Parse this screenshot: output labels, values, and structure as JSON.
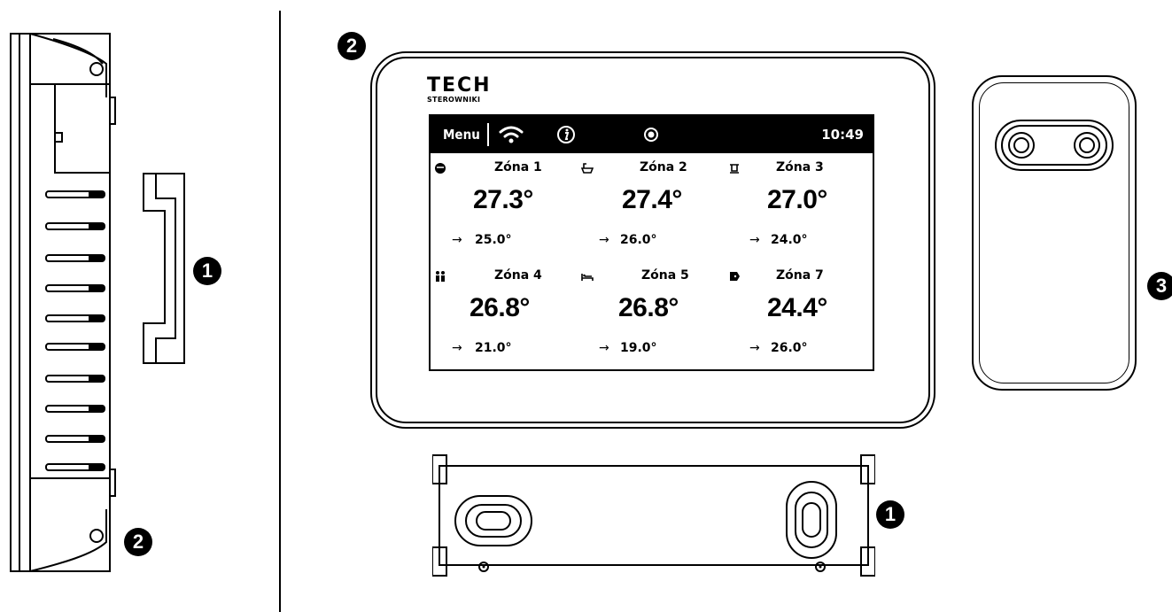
{
  "callouts": {
    "bracket_side": "1",
    "device_side": "2",
    "device_front": "2",
    "bracket_bottom": "1",
    "sensor": "3"
  },
  "device": {
    "logo_main": "TECH",
    "logo_sub": "STEROWNIKI",
    "topbar": {
      "menu_label": "Menu",
      "wifi_icon": "wifi-icon",
      "info_icon": "info-icon",
      "record_icon": "record-icon",
      "time": "10:49"
    },
    "zones": [
      {
        "icon": "radiator-icon",
        "name": "Zóna 1",
        "current": "27.3°",
        "arrow": "→",
        "setpoint": "25.0°"
      },
      {
        "icon": "bathtub-icon",
        "name": "Zóna 2",
        "current": "27.4°",
        "arrow": "→",
        "setpoint": "26.0°"
      },
      {
        "icon": "kitchen-icon",
        "name": "Zóna 3",
        "current": "27.0°",
        "arrow": "→",
        "setpoint": "24.0°"
      },
      {
        "icon": "family-icon",
        "name": "Zóna 4",
        "current": "26.8°",
        "arrow": "→",
        "setpoint": "21.0°"
      },
      {
        "icon": "bed-icon",
        "name": "Zóna 5",
        "current": "26.8°",
        "arrow": "→",
        "setpoint": "19.0°"
      },
      {
        "icon": "door-icon",
        "name": "Zóna 7",
        "current": "24.4°",
        "arrow": "→",
        "setpoint": "26.0°"
      }
    ]
  }
}
